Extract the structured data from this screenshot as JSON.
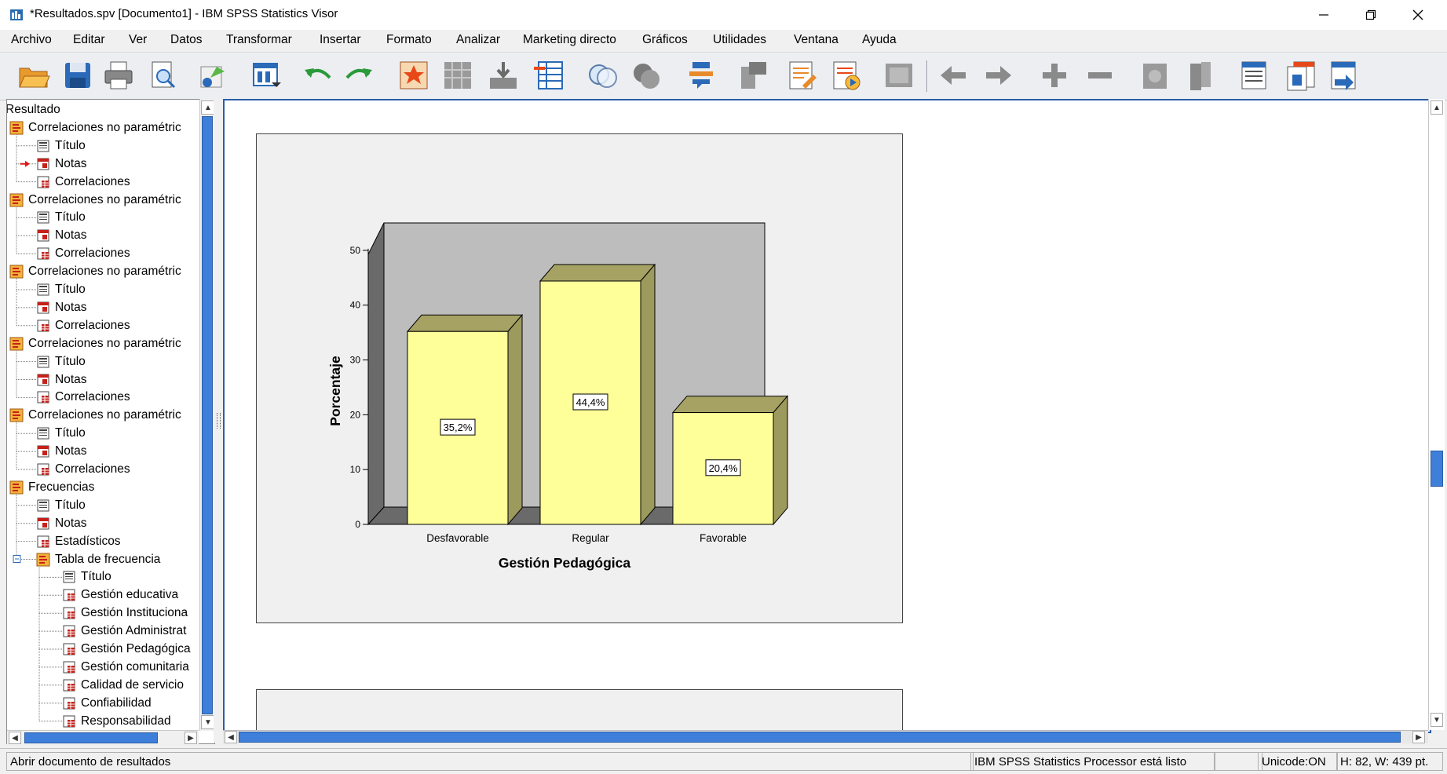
{
  "window": {
    "title": "*Resultados.spv [Documento1] - IBM SPSS Statistics Visor",
    "controls": [
      "minimize",
      "restore",
      "close"
    ]
  },
  "menu": [
    "Archivo",
    "Editar",
    "Ver",
    "Datos",
    "Transformar",
    "Insertar",
    "Formato",
    "Analizar",
    "Marketing directo",
    "Gráficos",
    "Utilidades",
    "Ventana",
    "Ayuda"
  ],
  "toolbar": {
    "buttons": [
      "open-icon",
      "save-icon",
      "print-icon",
      "print-preview-icon",
      "export-icon",
      "recall-dialog-icon",
      "undo-icon",
      "redo-icon",
      "goto-data-icon",
      "goto-case-icon",
      "goto-variable-icon",
      "variables-icon",
      "create-title-icon",
      "select-cases-icon",
      "designate-window-icon",
      "run-script-icon",
      "insert-heading-icon",
      "insert-title-icon",
      "insert-text-icon",
      "insert-chart-icon",
      "promote-icon",
      "demote-icon",
      "expand-icon",
      "collapse-icon",
      "show-icon",
      "hide-icon",
      "select-last-output-icon",
      "insert-table-icon",
      "export-output-icon"
    ]
  },
  "tree": {
    "root": "Resultado",
    "items": [
      {
        "label": "Correlaciones no paramétric",
        "level": 0,
        "icon": "folder-output-icon"
      },
      {
        "label": "Título",
        "level": 1,
        "icon": "title-icon"
      },
      {
        "label": "Notas",
        "level": 1,
        "icon": "notes-icon",
        "selected": true
      },
      {
        "label": "Correlaciones",
        "level": 1,
        "icon": "table-icon"
      },
      {
        "label": "Correlaciones no paramétric",
        "level": 0,
        "icon": "folder-output-icon"
      },
      {
        "label": "Título",
        "level": 1,
        "icon": "title-icon"
      },
      {
        "label": "Notas",
        "level": 1,
        "icon": "notes-icon"
      },
      {
        "label": "Correlaciones",
        "level": 1,
        "icon": "table-icon"
      },
      {
        "label": "Correlaciones no paramétric",
        "level": 0,
        "icon": "folder-output-icon"
      },
      {
        "label": "Título",
        "level": 1,
        "icon": "title-icon"
      },
      {
        "label": "Notas",
        "level": 1,
        "icon": "notes-icon"
      },
      {
        "label": "Correlaciones",
        "level": 1,
        "icon": "table-icon"
      },
      {
        "label": "Correlaciones no paramétric",
        "level": 0,
        "icon": "folder-output-icon"
      },
      {
        "label": "Título",
        "level": 1,
        "icon": "title-icon"
      },
      {
        "label": "Notas",
        "level": 1,
        "icon": "notes-icon"
      },
      {
        "label": "Correlaciones",
        "level": 1,
        "icon": "table-icon"
      },
      {
        "label": "Correlaciones no paramétric",
        "level": 0,
        "icon": "folder-output-icon"
      },
      {
        "label": "Título",
        "level": 1,
        "icon": "title-icon"
      },
      {
        "label": "Notas",
        "level": 1,
        "icon": "notes-icon"
      },
      {
        "label": "Correlaciones",
        "level": 1,
        "icon": "table-icon"
      },
      {
        "label": "Frecuencias",
        "level": 0,
        "icon": "folder-output-icon"
      },
      {
        "label": "Título",
        "level": 1,
        "icon": "title-icon"
      },
      {
        "label": "Notas",
        "level": 1,
        "icon": "notes-icon"
      },
      {
        "label": "Estadísticos",
        "level": 1,
        "icon": "table-icon"
      },
      {
        "label": "Tabla de frecuencia",
        "level": 1,
        "icon": "folder-output-icon",
        "expanded": true
      },
      {
        "label": "Título",
        "level": 2,
        "icon": "title-icon"
      },
      {
        "label": "Gestión educativa",
        "level": 2,
        "icon": "table-icon"
      },
      {
        "label": "Gestión Instituciona",
        "level": 2,
        "icon": "table-icon"
      },
      {
        "label": "Gestión Administrat",
        "level": 2,
        "icon": "table-icon"
      },
      {
        "label": "Gestión Pedagógica",
        "level": 2,
        "icon": "table-icon"
      },
      {
        "label": "Gestión comunitaria",
        "level": 2,
        "icon": "table-icon"
      },
      {
        "label": "Calidad de servicio",
        "level": 2,
        "icon": "table-icon"
      },
      {
        "label": "Confiabilidad",
        "level": 2,
        "icon": "table-icon"
      },
      {
        "label": "Responsabilidad",
        "level": 2,
        "icon": "table-icon"
      }
    ]
  },
  "chart_data": {
    "type": "bar",
    "categories": [
      "Desfavorable",
      "Regular",
      "Favorable"
    ],
    "values": [
      35.2,
      44.4,
      20.4
    ],
    "data_labels": [
      "35,2%",
      "44,4%",
      "20,4%"
    ],
    "xlabel": "Gestión Pedagógica",
    "ylabel": "Porcentaje",
    "ylim": [
      0,
      55
    ],
    "yticks": [
      0,
      10,
      20,
      30,
      40,
      50
    ],
    "bar_color": "#ffff99",
    "bar_side_color": "#9c9a5c",
    "bar_top_color": "#a6a264",
    "background_color": "#bdbdbd",
    "style": "3d"
  },
  "status": {
    "message": "Abrir documento de resultados",
    "processor": "IBM SPSS Statistics Processor está listo",
    "unicode": "Unicode:ON",
    "dimensions": "H: 82, W: 439 pt."
  }
}
